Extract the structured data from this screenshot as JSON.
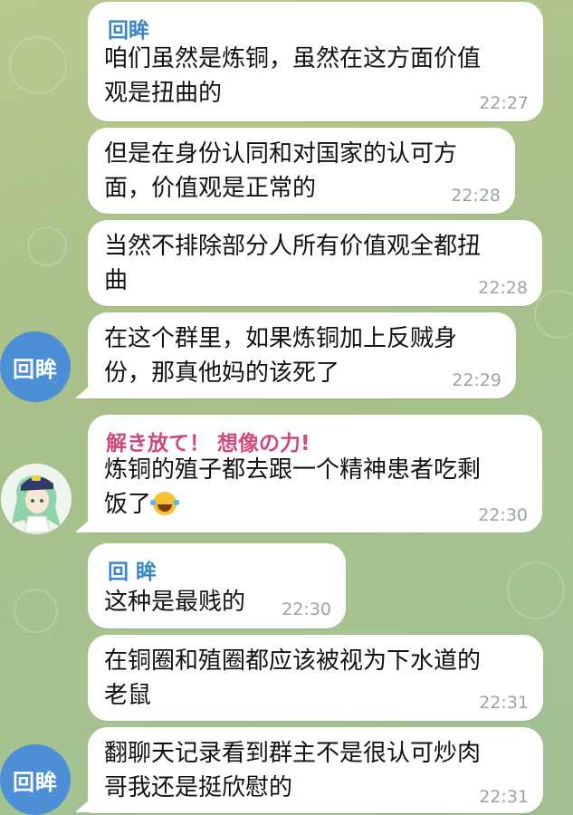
{
  "messages": [
    {
      "sender": "回眸",
      "lines": [
        "咱们虽然是炼铜，虽然在这方面价值",
        "观是扭曲的"
      ],
      "time": "22:27"
    },
    {
      "lines": [
        "但是在身份认同和对国家的认可方",
        "面，价值观是正常的"
      ],
      "time": "22:28"
    },
    {
      "lines": [
        "当然不排除部分人所有价值观全都扭",
        "曲"
      ],
      "time": "22:28"
    },
    {
      "lines": [
        "在这个群里，如果炼铜加上反贼身",
        "份，那真他妈的该死了"
      ],
      "time": "22:29"
    },
    {
      "sender": "解き放て！ 想像の力!",
      "lines": [
        "炼铜的殖子都去跟一个精神患者吃剩",
        "饭了"
      ],
      "time": "22:30",
      "emoji": "laughing-with-tears"
    },
    {
      "sender": "回 眸",
      "lines": [
        "这种是最贱的"
      ],
      "time": "22:30"
    },
    {
      "lines": [
        "在铜圈和殖圈都应该被视为下水道的",
        "老鼠"
      ],
      "time": "22:31"
    },
    {
      "lines": [
        "翻聊天记录看到群主不是很认可炒肉",
        "哥我还是挺欣慰的"
      ],
      "time": "22:31"
    }
  ],
  "avatars": {
    "user1_label": "回眸",
    "user2_label": "回眸",
    "anime_avatar_icon": "anime-character-avatar"
  }
}
